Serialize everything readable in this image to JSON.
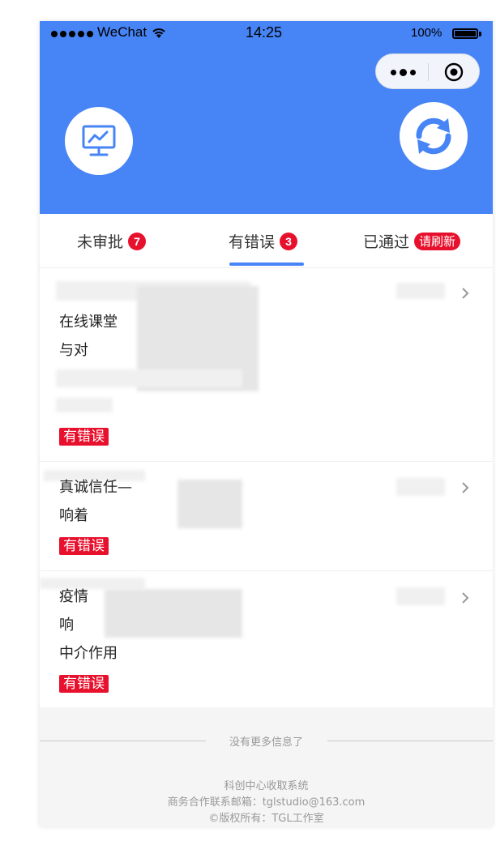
{
  "status_bar": {
    "carrier": "WeChat",
    "time": "14:25",
    "battery": "100%"
  },
  "header": {
    "left_icon": "monitor-chart-icon",
    "right_icon": "refresh-icon",
    "background_color": "#4784f6"
  },
  "tabs": [
    {
      "label": "未审批",
      "badge": "7",
      "active": false
    },
    {
      "label": "有错误",
      "badge": "3",
      "active": true
    },
    {
      "label": "已通过",
      "badge": "请刷新",
      "active": false
    }
  ],
  "items": [
    {
      "title_lines": [
        "在线课堂",
        "与对",
        ""
      ],
      "tag": "有错误"
    },
    {
      "title_lines": [
        "真诚信任—",
        "响着"
      ],
      "tag": "有错误"
    },
    {
      "title_lines": [
        "疫情",
        "响",
        "中介作用"
      ],
      "tag": "有错误"
    }
  ],
  "footer": {
    "no_more": "没有更多信息了",
    "system_name": "科创中心收取系统",
    "contact": "商务合作联系邮箱：tglstudio@163.com",
    "copyright": "©版权所有：TGL工作室"
  },
  "colors": {
    "accent": "#4784f6",
    "badge": "#e8112d"
  }
}
